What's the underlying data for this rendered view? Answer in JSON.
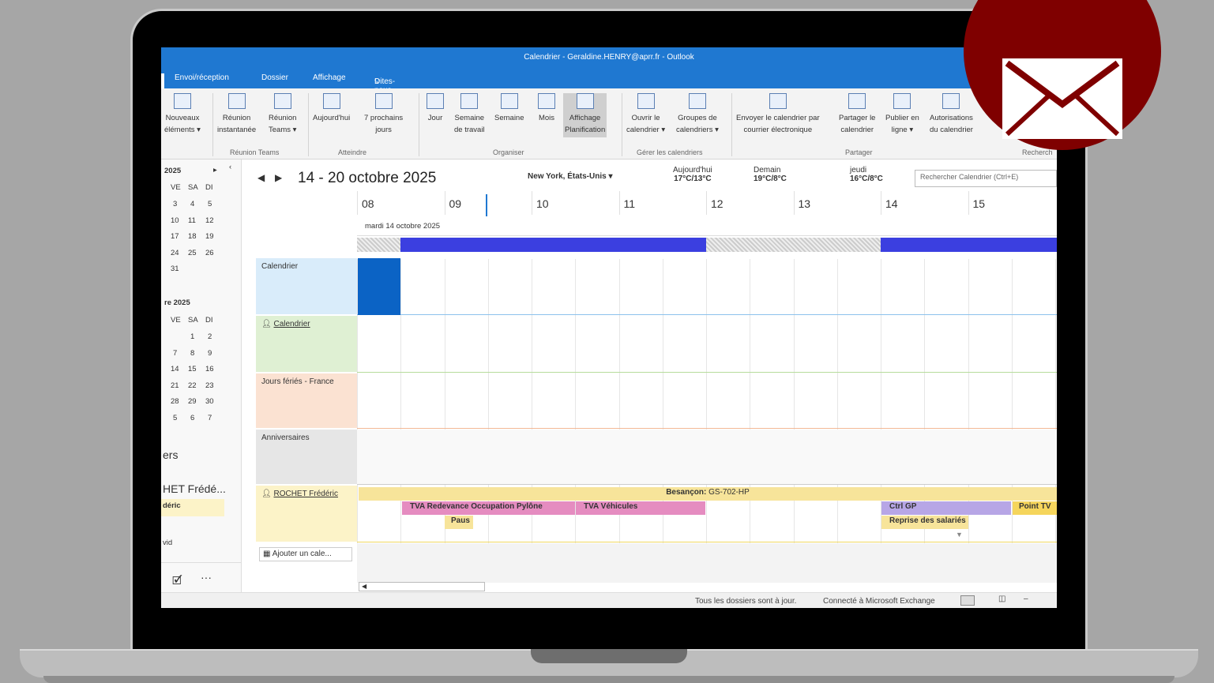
{
  "window_title": "Calendrier - Geraldine.HENRY@aprr.fr - Outlook",
  "tabs": [
    "Envoi/réception",
    "Dossier",
    "Affichage"
  ],
  "tell_me": "Dites-nous ce que vous voulez faire.",
  "ribbon": {
    "buttons": [
      {
        "l1": "Nouveaux",
        "l2": "éléments ▾"
      },
      {
        "l1": "Réunion",
        "l2": "instantanée"
      },
      {
        "l1": "Réunion",
        "l2": "Teams ▾"
      },
      {
        "l1": "Aujourd'hui",
        "l2": ""
      },
      {
        "l1": "7 prochains",
        "l2": "jours"
      },
      {
        "l1": "Jour",
        "l2": ""
      },
      {
        "l1": "Semaine",
        "l2": "de travail"
      },
      {
        "l1": "Semaine",
        "l2": ""
      },
      {
        "l1": "Mois",
        "l2": ""
      },
      {
        "l1": "Affichage",
        "l2": "Planification"
      },
      {
        "l1": "Ouvrir le",
        "l2": "calendrier ▾"
      },
      {
        "l1": "Groupes de",
        "l2": "calendriers ▾"
      },
      {
        "l1": "Envoyer le calendrier par",
        "l2": "courrier électronique"
      },
      {
        "l1": "Partager le",
        "l2": "calendrier"
      },
      {
        "l1": "Publier en",
        "l2": "ligne ▾"
      },
      {
        "l1": "Autorisations",
        "l2": "du calendrier"
      }
    ],
    "groups": [
      "Réunion Teams",
      "Atteindre",
      "Organiser",
      "Gérer les calendriers",
      "Partager",
      "Recherch"
    ]
  },
  "mini_cal_1": {
    "title": "2025",
    "days": [
      "VE",
      "SA",
      "DI"
    ],
    "rows": [
      [
        "3",
        "4",
        "5"
      ],
      [
        "10",
        "11",
        "12"
      ],
      [
        "17",
        "18",
        "19"
      ],
      [
        "24",
        "25",
        "26"
      ],
      [
        "31",
        "",
        ""
      ]
    ]
  },
  "mini_cal_2": {
    "title": "re 2025",
    "days": [
      "VE",
      "SA",
      "DI"
    ],
    "rows": [
      [
        "",
        "1",
        "2"
      ],
      [
        "7",
        "8",
        "9"
      ],
      [
        "14",
        "15",
        "16"
      ],
      [
        "21",
        "22",
        "23"
      ],
      [
        "28",
        "29",
        "30"
      ],
      [
        "5",
        "6",
        "7"
      ]
    ]
  },
  "nav_folders": {
    "a": "ers",
    "b": "HET Frédé...",
    "c": "déric",
    "d": "vid"
  },
  "header": {
    "range": "14 - 20 octobre 2025",
    "location": "New York, États-Unis",
    "weather": [
      {
        "day": "Aujourd'hui",
        "temp": "17°C/13°C"
      },
      {
        "day": "Demain",
        "temp": "19°C/8°C"
      },
      {
        "day": "jeudi",
        "temp": "16°C/8°C"
      }
    ],
    "search_placeholder": "Rechercher Calendrier (Ctrl+E)"
  },
  "hours": [
    "08",
    "09",
    "10",
    "11",
    "12",
    "13",
    "14",
    "15"
  ],
  "day_label": "mardi 14 octobre 2025",
  "calendars": [
    "Calendrier",
    "Calendrier",
    "Jours fériés - France",
    "Anniversaires",
    "ROCHET Frédéric"
  ],
  "add_calendar": "Ajouter un cale...",
  "events": {
    "allday_prefix": "Besançon:",
    "allday_rest": " GS-702-HP",
    "tva_pylone": "TVA Redevance Occupation Pylône",
    "tva_vehicules": "TVA Véhicules",
    "pause": "Paus",
    "ctrl_gp": "Ctrl GP",
    "point_tv": "Point TV",
    "reprise": "Reprise des salariés"
  },
  "status": {
    "sync": "Tous les dossiers sont à jour.",
    "connection": "Connecté à Microsoft Exchange"
  },
  "colors": {
    "outlook_blue": "#1f78d1",
    "busy": "#3b3fe0",
    "badge": "#7f0000"
  }
}
